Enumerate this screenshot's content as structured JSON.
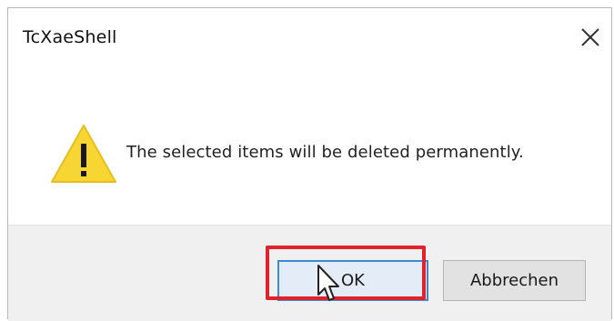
{
  "dialog": {
    "title": "TcXaeShell",
    "message": "The selected items will be deleted permanently.",
    "icon": "warning-icon",
    "close_icon": "close-icon"
  },
  "buttons": {
    "ok_label": "OK",
    "cancel_label": "Abbrechen"
  },
  "colors": {
    "warning_yellow": "#f7d633",
    "footer_bg": "#f0f0f0",
    "ok_border": "#3b8ad6",
    "highlight_red": "#e0222c"
  }
}
